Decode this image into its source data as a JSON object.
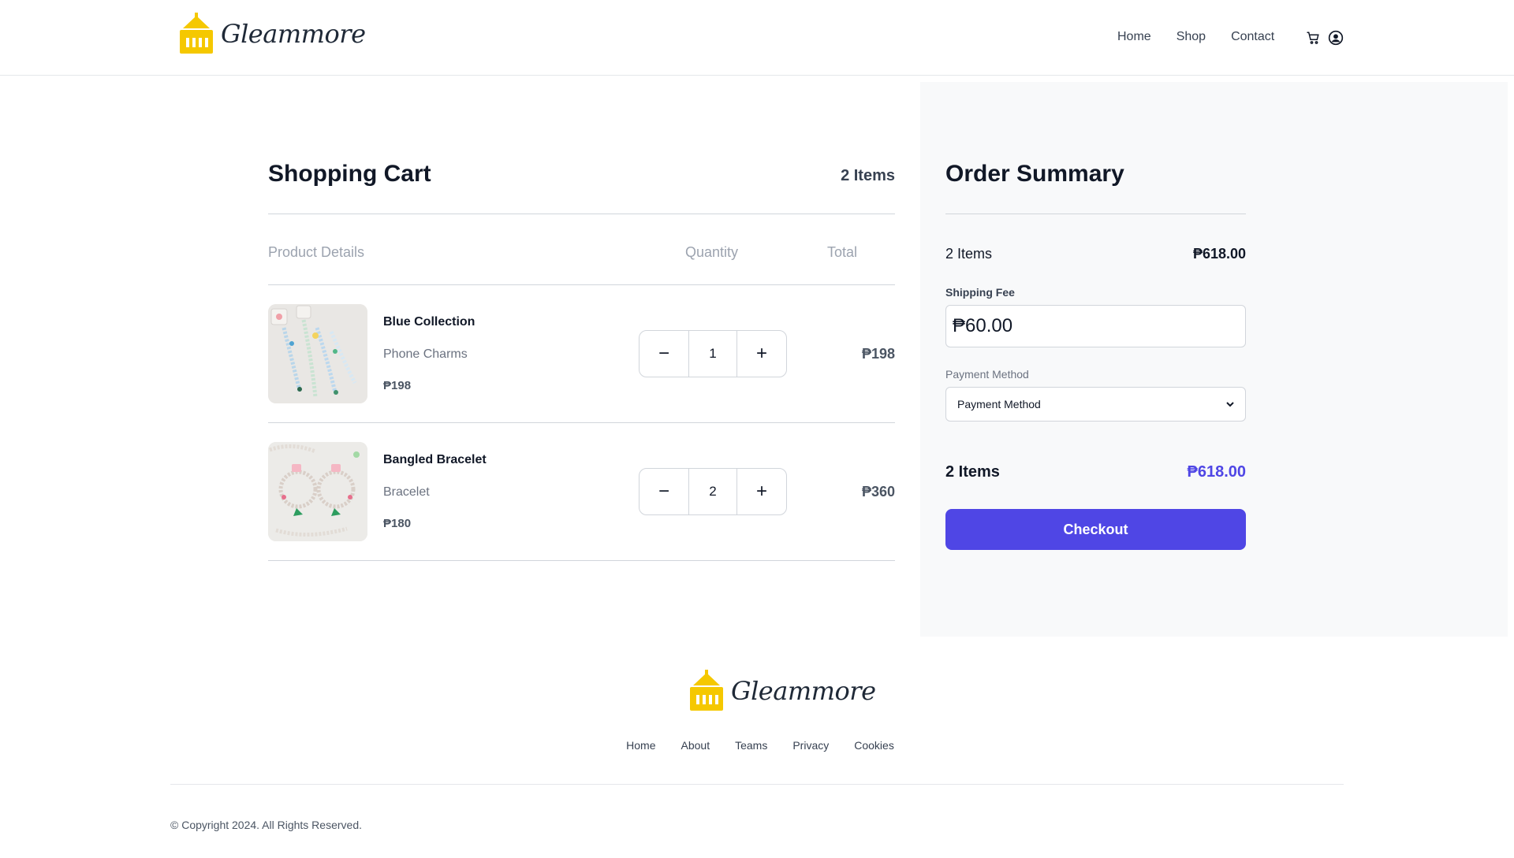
{
  "brand": {
    "name": "Gleammore",
    "logo_color": "#f5c800"
  },
  "nav": {
    "items": [
      "Home",
      "Shop",
      "Contact"
    ],
    "icons": [
      "cart-icon",
      "user-circle-icon"
    ]
  },
  "cart": {
    "title": "Shopping Cart",
    "count_label": "2 Items",
    "columns": {
      "product": "Product Details",
      "quantity": "Quantity",
      "total": "Total"
    },
    "items": [
      {
        "name": "Blue Collection",
        "category": "Phone Charms",
        "price": "₱198",
        "quantity": "1",
        "total": "₱198"
      },
      {
        "name": "Bangled Bracelet",
        "category": "Bracelet",
        "price": "₱180",
        "quantity": "2",
        "total": "₱360"
      }
    ]
  },
  "summary": {
    "title": "Order Summary",
    "items_label": "2 Items",
    "subtotal": "₱618.00",
    "shipping_label": "Shipping Fee",
    "shipping_value": "₱60.00",
    "payment_label": "Payment Method",
    "payment_selected": "Payment Method",
    "total_items_label": "2 Items",
    "total": "₱618.00",
    "checkout_label": "Checkout",
    "accent": "#4f46e5"
  },
  "footer": {
    "links": [
      "Home",
      "About",
      "Teams",
      "Privacy",
      "Cookies"
    ],
    "copyright": "© Copyright 2024. All Rights Reserved."
  }
}
